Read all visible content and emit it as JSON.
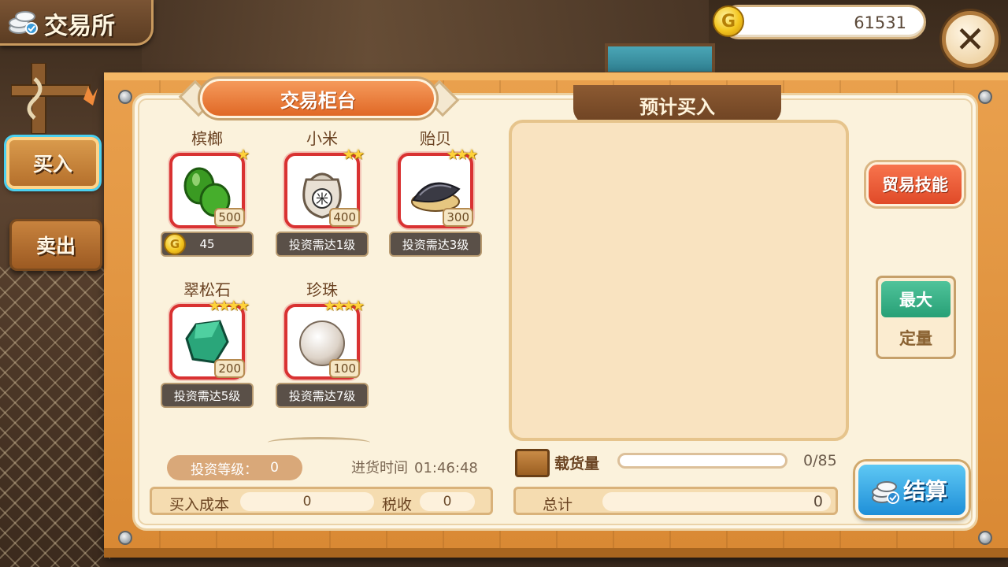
{
  "header": {
    "title": "交易所",
    "coins": "61531"
  },
  "tabs": {
    "buy": "买入",
    "sell": "卖出"
  },
  "counter": {
    "title": "交易柜台"
  },
  "items": [
    {
      "name": "槟榔",
      "stars": "★",
      "qty": "500",
      "bar": "45",
      "has_price": true
    },
    {
      "name": "小米",
      "stars": "★★",
      "qty": "400",
      "bar": "投资需达1级",
      "has_price": false
    },
    {
      "name": "贻贝",
      "stars": "★★★",
      "qty": "300",
      "bar": "投资需达3级",
      "has_price": false
    },
    {
      "name": "翠松石",
      "stars": "★★★★",
      "qty": "200",
      "bar": "投资需达5级",
      "has_price": false
    },
    {
      "name": "珍珠",
      "stars": "★★★★",
      "qty": "100",
      "bar": "投资需达7级",
      "has_price": false
    }
  ],
  "estimate": {
    "title": "预计买入"
  },
  "buttons": {
    "skill": "贸易技能",
    "max": "最大",
    "fixed": "定量",
    "checkout": "结算"
  },
  "invest": {
    "label": "投资等级：",
    "value": "0"
  },
  "restock": {
    "label": "进货时间",
    "value": "01:46:48"
  },
  "cost": {
    "label": "买入成本",
    "value": "0",
    "tax_label": "税收",
    "tax_value": "0"
  },
  "cargo": {
    "label": "载货量",
    "count": "0/85",
    "fill_fraction": 0
  },
  "total": {
    "label": "总计",
    "value": "0"
  },
  "colors": {
    "accent": "#e06826",
    "checkout": "#1f8fd8",
    "max": "#28a076"
  }
}
